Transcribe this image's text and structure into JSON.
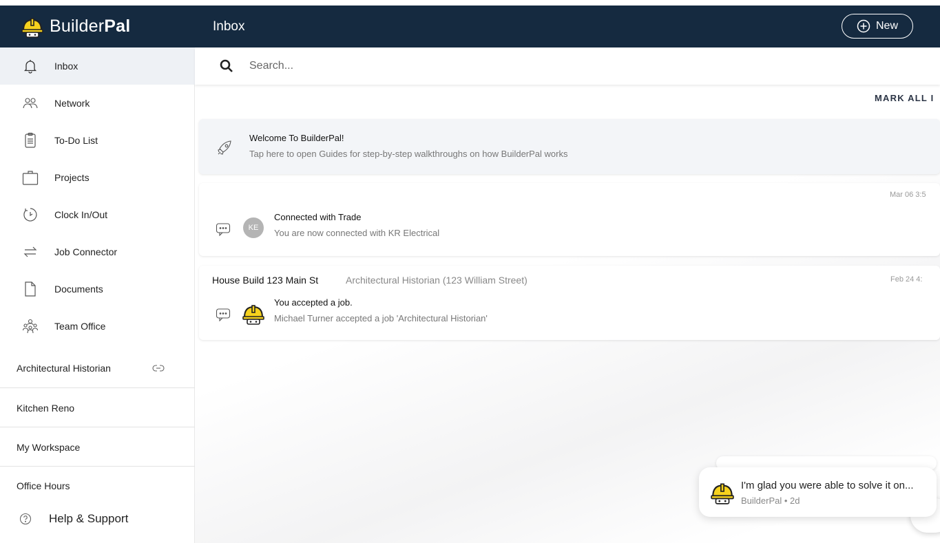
{
  "app": {
    "brand_regular": "Builder",
    "brand_bold": "Pal",
    "page_title": "Inbox"
  },
  "header": {
    "new_label": "New"
  },
  "sidebar": {
    "items": [
      {
        "label": "Inbox",
        "icon": "bell-icon"
      },
      {
        "label": "Network",
        "icon": "people-icon"
      },
      {
        "label": "To-Do List",
        "icon": "clipboard-icon"
      },
      {
        "label": "Projects",
        "icon": "briefcase-icon"
      },
      {
        "label": "Clock In/Out",
        "icon": "timer-icon"
      },
      {
        "label": "Job Connector",
        "icon": "arrows-icon"
      },
      {
        "label": "Documents",
        "icon": "document-icon"
      },
      {
        "label": "Team Office",
        "icon": "team-icon"
      }
    ],
    "workspaces": [
      {
        "label": "Architectural Historian"
      },
      {
        "label": "Kitchen Reno"
      },
      {
        "label": "My Workspace"
      },
      {
        "label": "Office Hours"
      }
    ],
    "help_label": "Help & Support"
  },
  "search": {
    "placeholder": "Search..."
  },
  "inbox": {
    "mark_all_label": "MARK ALL I",
    "welcome": {
      "title": "Welcome To BuilderPal!",
      "subtitle": "Tap here to open Guides for step-by-step walkthroughs on how BuilderPal works"
    },
    "messages": [
      {
        "time": "Mar 06 3:5",
        "avatar_initials": "KE",
        "title": "Connected with Trade",
        "subtitle": "You are now connected with KR Electrical"
      },
      {
        "project": "House Build 123 Main St",
        "project_sub": "Architectural Historian (123 William Street)",
        "time": "Feb 24 4:",
        "title": "You accepted a job.",
        "subtitle": "Michael Turner accepted a job 'Architectural Historian'"
      }
    ]
  },
  "toast": {
    "message": "I'm glad you were able to solve it on...",
    "meta": "BuilderPal • 2d"
  },
  "colors": {
    "header_bg": "#152a40",
    "hat_yellow": "#f6d21d",
    "active_nav_bg": "#eef1f5"
  }
}
